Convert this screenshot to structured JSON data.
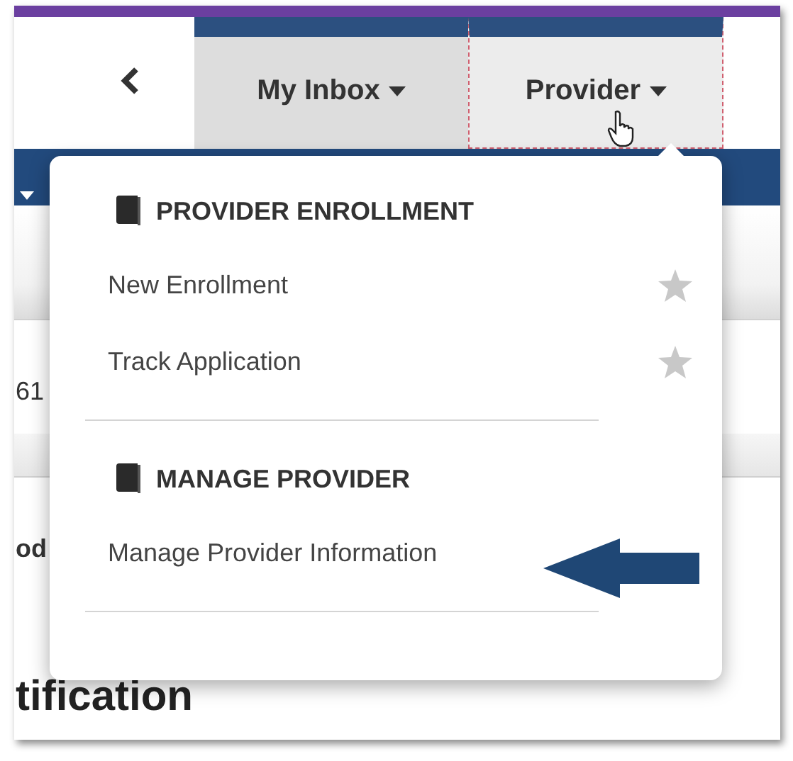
{
  "tabs": [
    {
      "label": "My Inbox",
      "selected": false
    },
    {
      "label": "Provider",
      "selected": true
    }
  ],
  "page": {
    "row_text_1": "61",
    "row_text_2": "od",
    "heading": "tification"
  },
  "menu": {
    "sections": [
      {
        "heading": "PROVIDER ENROLLMENT",
        "items": [
          {
            "label": "New Enrollment",
            "star": true
          },
          {
            "label": "Track Application",
            "star": true
          }
        ]
      },
      {
        "heading": "MANAGE PROVIDER",
        "items": [
          {
            "label": "Manage Provider Information",
            "star": false
          }
        ]
      }
    ]
  }
}
